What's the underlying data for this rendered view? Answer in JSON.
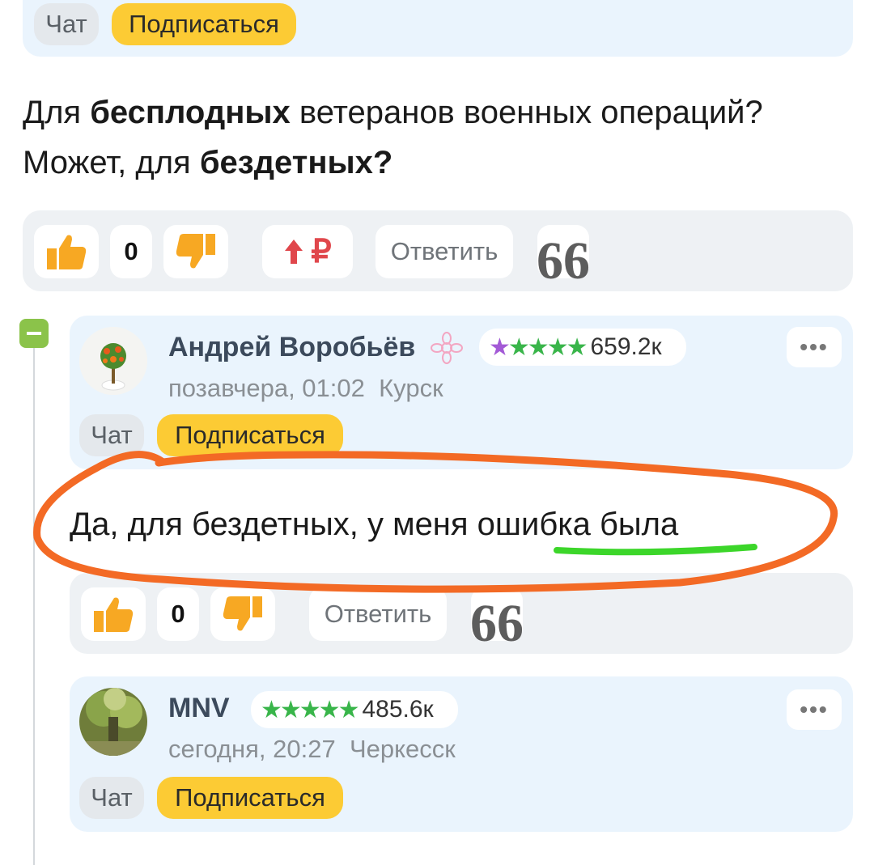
{
  "top_card": {
    "chat_label": "Чат",
    "subscribe_label": "Подписаться"
  },
  "post": {
    "line1_a": "Для ",
    "line1_b": "бесплодных",
    "line1_c": " ветеранов военных операций?",
    "line2_a": "Может, для ",
    "line2_b": "бездетных?"
  },
  "post_actions": {
    "like_count": "0",
    "ruble_symbol": "₽",
    "reply_label": "Ответить",
    "quote_symbol": "66"
  },
  "comment1": {
    "author": "Андрей Воробьёв",
    "rating_value": "659.2к",
    "date": "позавчера, 01:02",
    "city": "Курск",
    "chat_label": "Чат",
    "subscribe_label": "Подписаться",
    "more_symbol": "•••",
    "text": "Да, для бездетных, у меня ошибка была",
    "like_count": "0",
    "reply_label": "Ответить",
    "quote_symbol": "66"
  },
  "comment2": {
    "author": "MNV",
    "rating_value": "485.6к",
    "date": "сегодня, 20:27",
    "city": "Черкесск",
    "chat_label": "Чат",
    "subscribe_label": "Подписаться",
    "more_symbol": "•••"
  },
  "thread_toggle_symbol": "−",
  "colors": {
    "accent_yellow": "#fccb34",
    "thumb_orange": "#f7a823",
    "ruble_red": "#e0474c",
    "annotation_orange": "#f36a25",
    "annotation_green": "#3cd62a",
    "stars_green": "#39b54a",
    "card_blue": "#eaf4fd",
    "collapse_green": "#8bc34a"
  }
}
